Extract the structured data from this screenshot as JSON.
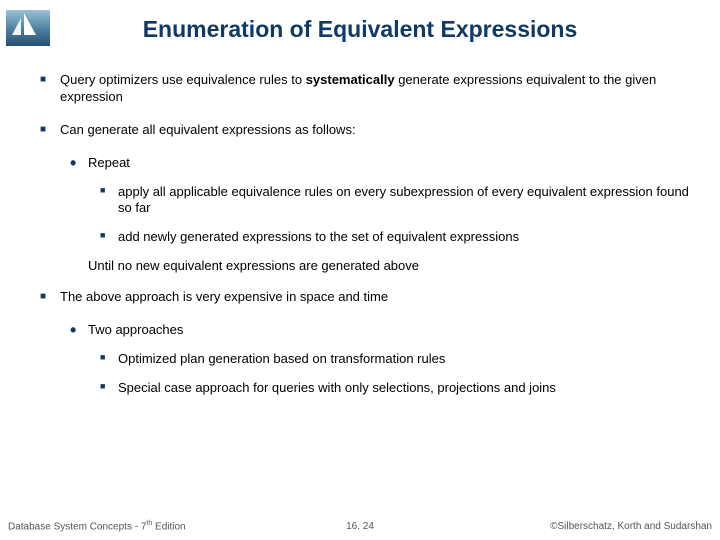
{
  "title": "Enumeration of Equivalent Expressions",
  "bullets": {
    "b1a_1": "Query optimizers use equivalence rules to ",
    "b1a_strong": "systematically",
    "b1a_2": " generate expressions equivalent to the given expression",
    "b1b": "Can generate all equivalent expressions as follows:",
    "b2a": "Repeat",
    "b3a": "apply all applicable equivalence  rules on every subexpression of every equivalent expression found so far",
    "b3b": "add newly generated expressions to the set of equivalent expressions",
    "until": "Until no new equivalent expressions are generated above",
    "b1c": "The above approach is very expensive in space and time",
    "b2b": "Two approaches",
    "b3c": "Optimized plan generation based on transformation rules",
    "b3d": "Special case approach for queries with only selections, projections and joins"
  },
  "footer": {
    "left_1": "Database System Concepts - 7",
    "left_sup": "th",
    "left_2": " Edition",
    "center": "16. 24",
    "right": "©Silberschatz, Korth and Sudarshan"
  }
}
